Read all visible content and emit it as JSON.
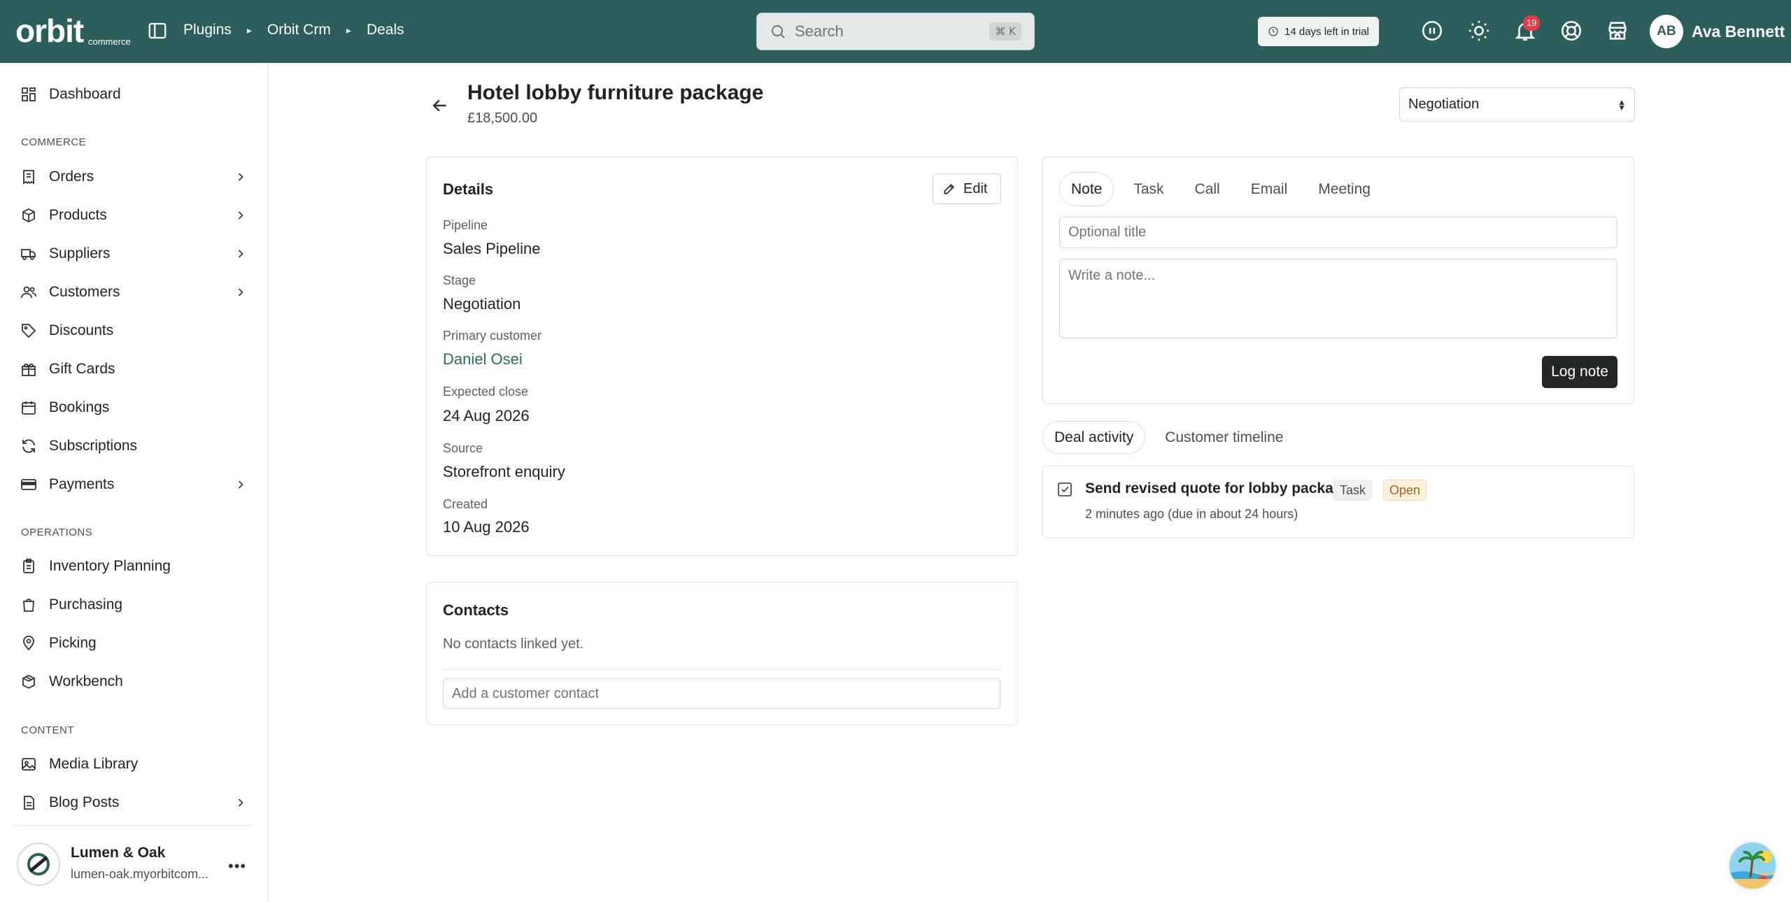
{
  "topbar": {
    "logo_text": "orbit",
    "logo_sub": "commerce",
    "breadcrumbs": [
      "Plugins",
      "Orbit Crm",
      "Deals"
    ],
    "search_placeholder": "Search",
    "search_shortcut": "⌘ K",
    "trial_text": "14 days left in trial",
    "notifications_count": "19",
    "user_initials": "AB",
    "user_name": "Ava Bennett",
    "background_color": "#2c5f5b"
  },
  "sidebar": {
    "dashboard": "Dashboard",
    "section_commerce": "COMMERCE",
    "orders": "Orders",
    "products": "Products",
    "suppliers": "Suppliers",
    "customers": "Customers",
    "discounts": "Discounts",
    "gift_cards": "Gift Cards",
    "bookings": "Bookings",
    "subscriptions": "Subscriptions",
    "payments": "Payments",
    "section_operations": "OPERATIONS",
    "inventory_planning": "Inventory Planning",
    "purchasing": "Purchasing",
    "picking": "Picking",
    "workbench": "Workbench",
    "section_content": "CONTENT",
    "media_library": "Media Library",
    "blog_posts": "Blog Posts",
    "store_name": "Lumen & Oak",
    "store_url": "lumen-oak.myorbitcom..."
  },
  "deal": {
    "title": "Hotel lobby furniture package",
    "amount": "£18,500.00",
    "stage_select": "Negotiation"
  },
  "details": {
    "heading": "Details",
    "edit_label": "Edit",
    "pipeline_label": "Pipeline",
    "pipeline_value": "Sales Pipeline",
    "stage_label": "Stage",
    "stage_value": "Negotiation",
    "customer_label": "Primary customer",
    "customer_value": "Daniel Osei",
    "close_label": "Expected close",
    "close_value": "24 Aug 2026",
    "source_label": "Source",
    "source_value": "Storefront enquiry",
    "created_label": "Created",
    "created_value": "10 Aug 2026"
  },
  "contacts": {
    "heading": "Contacts",
    "empty_text": "No contacts linked yet.",
    "add_placeholder": "Add a customer contact"
  },
  "composer": {
    "tabs": [
      "Note",
      "Task",
      "Call",
      "Email",
      "Meeting"
    ],
    "active_tab": "Note",
    "title_placeholder": "Optional title",
    "note_placeholder": "Write a note...",
    "submit_label": "Log note"
  },
  "activity": {
    "tabs": [
      "Deal activity",
      "Customer timeline"
    ],
    "active_tab": "Deal activity",
    "items": [
      {
        "title": "Send revised quote for lobby package",
        "type": "Task",
        "status": "Open",
        "time": "2 minutes ago (due in about 24 hours)"
      }
    ]
  }
}
